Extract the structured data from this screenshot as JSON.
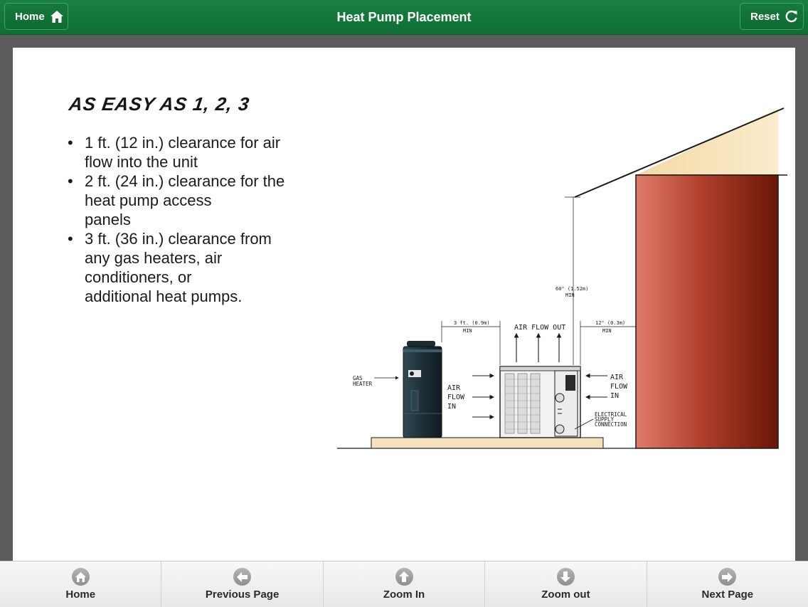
{
  "header": {
    "title": "Heat Pump Placement",
    "home_label": "Home",
    "reset_label": "Reset",
    "color": "#157a3b"
  },
  "content": {
    "heading": "AS EASY AS 1, 2, 3",
    "bullets": [
      "1 ft. (12 in.) clearance for air\n flow into the unit",
      "2 ft. (24 in.) clearance for the\nheat pump access\npanels",
      "3 ft. (36 in.) clearance from\nany gas heaters, air\nconditioners, or\nadditional heat pumps."
    ]
  },
  "diagram": {
    "gas_heater_line1": "GAS",
    "gas_heater_line2": "HEATER",
    "air_flow_out": "AIR FLOW OUT",
    "air_in_left": [
      "AIR",
      "FLOW",
      "IN"
    ],
    "air_in_right": [
      "AIR",
      "FLOW",
      "IN"
    ],
    "clear_left_line1": "3 ft. (0.9m)",
    "clear_left_line2": "MIN",
    "clear_top_line1": "60\" (1.52m)",
    "clear_top_line2": "MIN",
    "clear_right_line1": "12\" (0.3m)",
    "clear_right_line2": "MIN",
    "electrical": [
      "ELECTRICAL",
      "SUPPLY",
      "CONNECTION"
    ]
  },
  "footer": {
    "buttons": [
      {
        "label": "Home",
        "icon": "home-icon"
      },
      {
        "label": "Previous Page",
        "icon": "arrow-left-icon"
      },
      {
        "label": "Zoom In",
        "icon": "arrow-up-icon"
      },
      {
        "label": "Zoom out",
        "icon": "arrow-down-icon"
      },
      {
        "label": "Next Page",
        "icon": "arrow-right-icon"
      }
    ]
  }
}
